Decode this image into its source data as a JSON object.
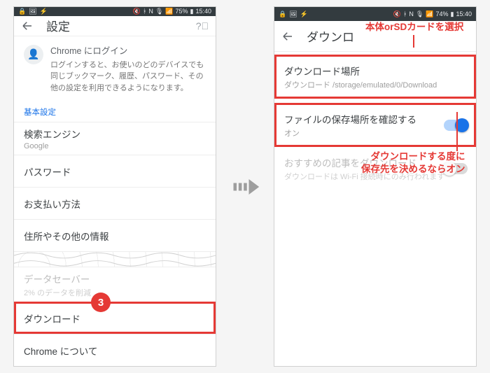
{
  "status": {
    "time": "15:40",
    "battery_l": "75%",
    "battery_r": "74%"
  },
  "left": {
    "title": "設定",
    "signin_title": "Chrome にログイン",
    "signin_desc": "ログインすると、お使いのどのデバイスでも同じブックマーク、履歴、パスワード、その他の設定を利用できるようになります。",
    "section": "基本設定",
    "search_engine": "検索エンジン",
    "search_engine_value": "Google",
    "passwords": "パスワード",
    "payments": "お支払い方法",
    "addresses": "住所やその他の情報",
    "datasaver": "データセーバー",
    "datasaver_sub": "2% のデータを削減",
    "download": "ダウンロード",
    "about": "Chrome について",
    "marker": "3"
  },
  "right": {
    "title": "ダウンロ",
    "dl_location_label": "ダウンロード場所",
    "dl_location_value": "ダウンロード /storage/emulated/0/Download",
    "confirm_label": "ファイルの保存場所を確認する",
    "confirm_sub": "オン",
    "recommend_label": "おすすめの記事をダウンロード",
    "recommend_sub": "ダウンロードは Wi-Fi 接続時にのみ行われます"
  },
  "annotations": {
    "top": "本体orSDカードを選択",
    "mid_l1": "ダウンロードする度に",
    "mid_l2": "保存先を決めるならオン"
  }
}
